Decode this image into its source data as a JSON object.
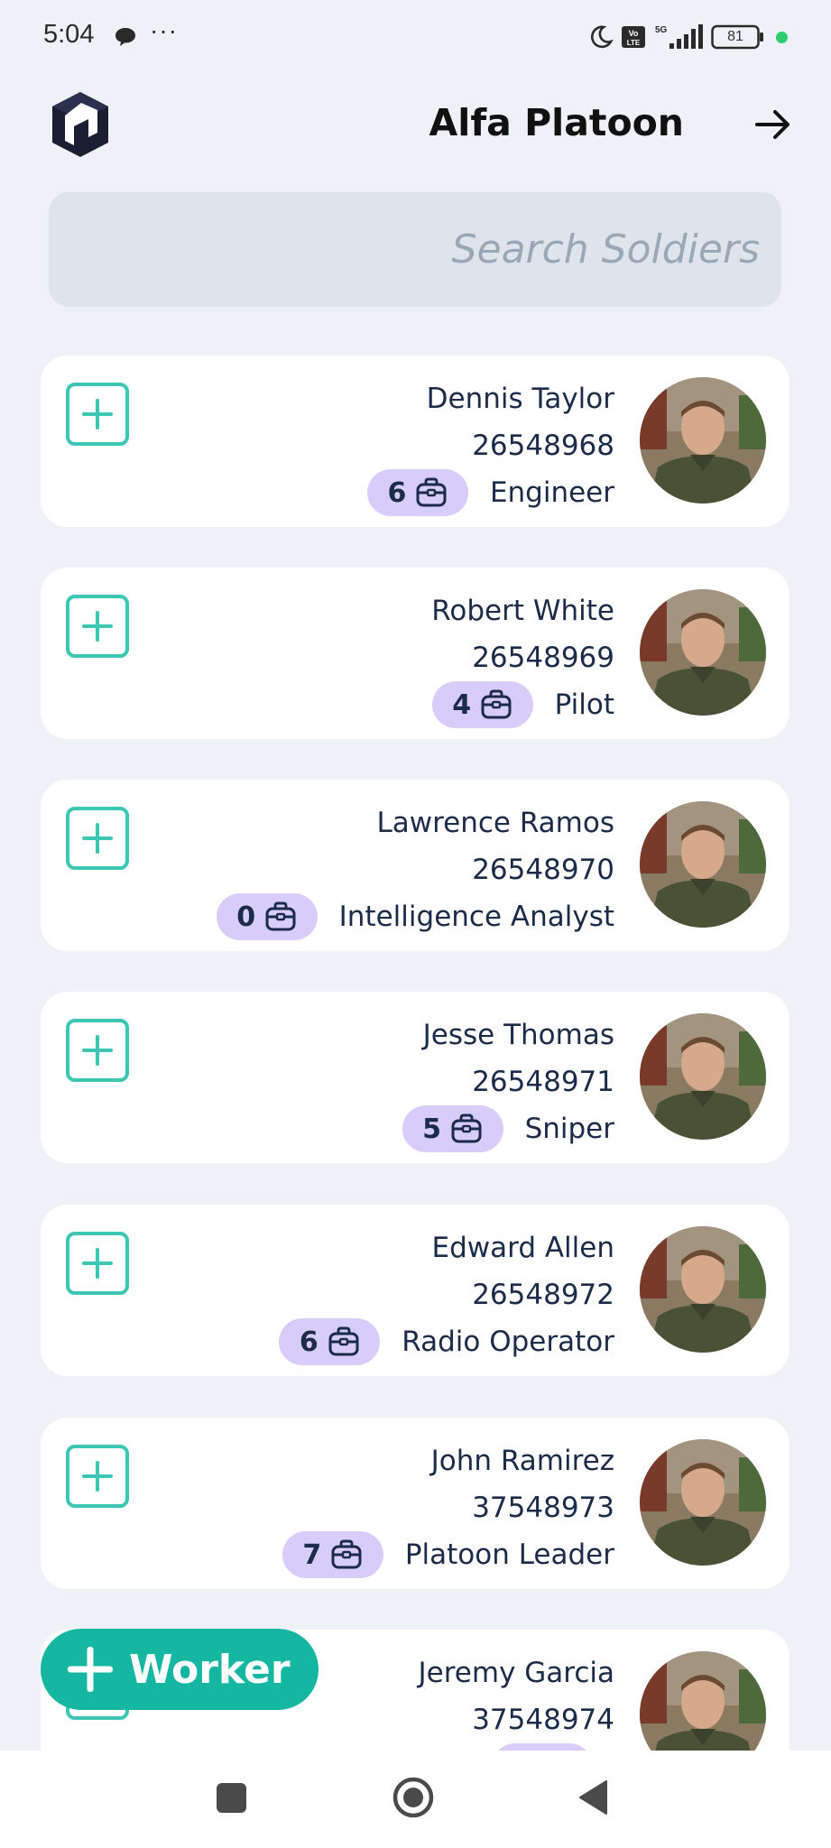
{
  "status_bar": {
    "time": "5:04",
    "dots": "···",
    "volte_label": "Vo LTE",
    "network": "5G",
    "battery": "81"
  },
  "header": {
    "title": "Alfa Platoon",
    "next_icon": "arrow-right-icon"
  },
  "search": {
    "placeholder": "Search Soldiers",
    "value": ""
  },
  "soldiers": [
    {
      "name": "Dennis Taylor",
      "id": "26548968",
      "role": "Engineer",
      "count": "6"
    },
    {
      "name": "Robert White",
      "id": "26548969",
      "role": "Pilot",
      "count": "4"
    },
    {
      "name": "Lawrence Ramos",
      "id": "26548970",
      "role": "Intelligence Analyst",
      "count": "0"
    },
    {
      "name": "Jesse Thomas",
      "id": "26548971",
      "role": "Sniper",
      "count": "5"
    },
    {
      "name": "Edward Allen",
      "id": "26548972",
      "role": "Radio Operator",
      "count": "6"
    },
    {
      "name": "John Ramirez",
      "id": "37548973",
      "role": "Platoon Leader",
      "count": "7"
    },
    {
      "name": "Jeremy Garcia",
      "id": "37548974",
      "role": "",
      "count": ""
    }
  ],
  "fab": {
    "label": "Worker"
  },
  "colors": {
    "accent": "#16b7a2",
    "badge": "#d8cdfa",
    "text": "#1b2b4a",
    "background": "#eef2f6"
  }
}
